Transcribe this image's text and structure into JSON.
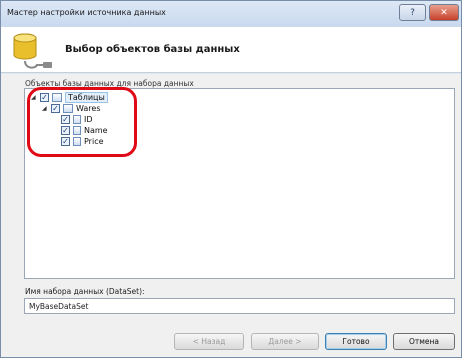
{
  "window": {
    "title": "Мастер настройки источника данных",
    "help_glyph": "?",
    "close_glyph": "✕"
  },
  "header": {
    "title": "Выбор объектов базы данных",
    "icon": "database-plug-icon"
  },
  "tree": {
    "label": "Объекты базы данных для набора данных",
    "root": {
      "label": "Таблицы",
      "checked": true,
      "expander": "◢"
    },
    "table": {
      "label": "Wares",
      "checked": true,
      "expander": "◢"
    },
    "columns": [
      {
        "label": "ID",
        "checked": true
      },
      {
        "label": "Name",
        "checked": true
      },
      {
        "label": "Price",
        "checked": true
      }
    ],
    "check_glyph": "✓"
  },
  "dataset": {
    "label": "Имя набора данных (DataSet):",
    "value": "MyBaseDataSet"
  },
  "buttons": {
    "back": "< Назад",
    "next": "Далее >",
    "finish": "Готово",
    "cancel": "Отмена"
  },
  "colors": {
    "highlight": "#e00a16",
    "close_button": "#c7412a"
  }
}
